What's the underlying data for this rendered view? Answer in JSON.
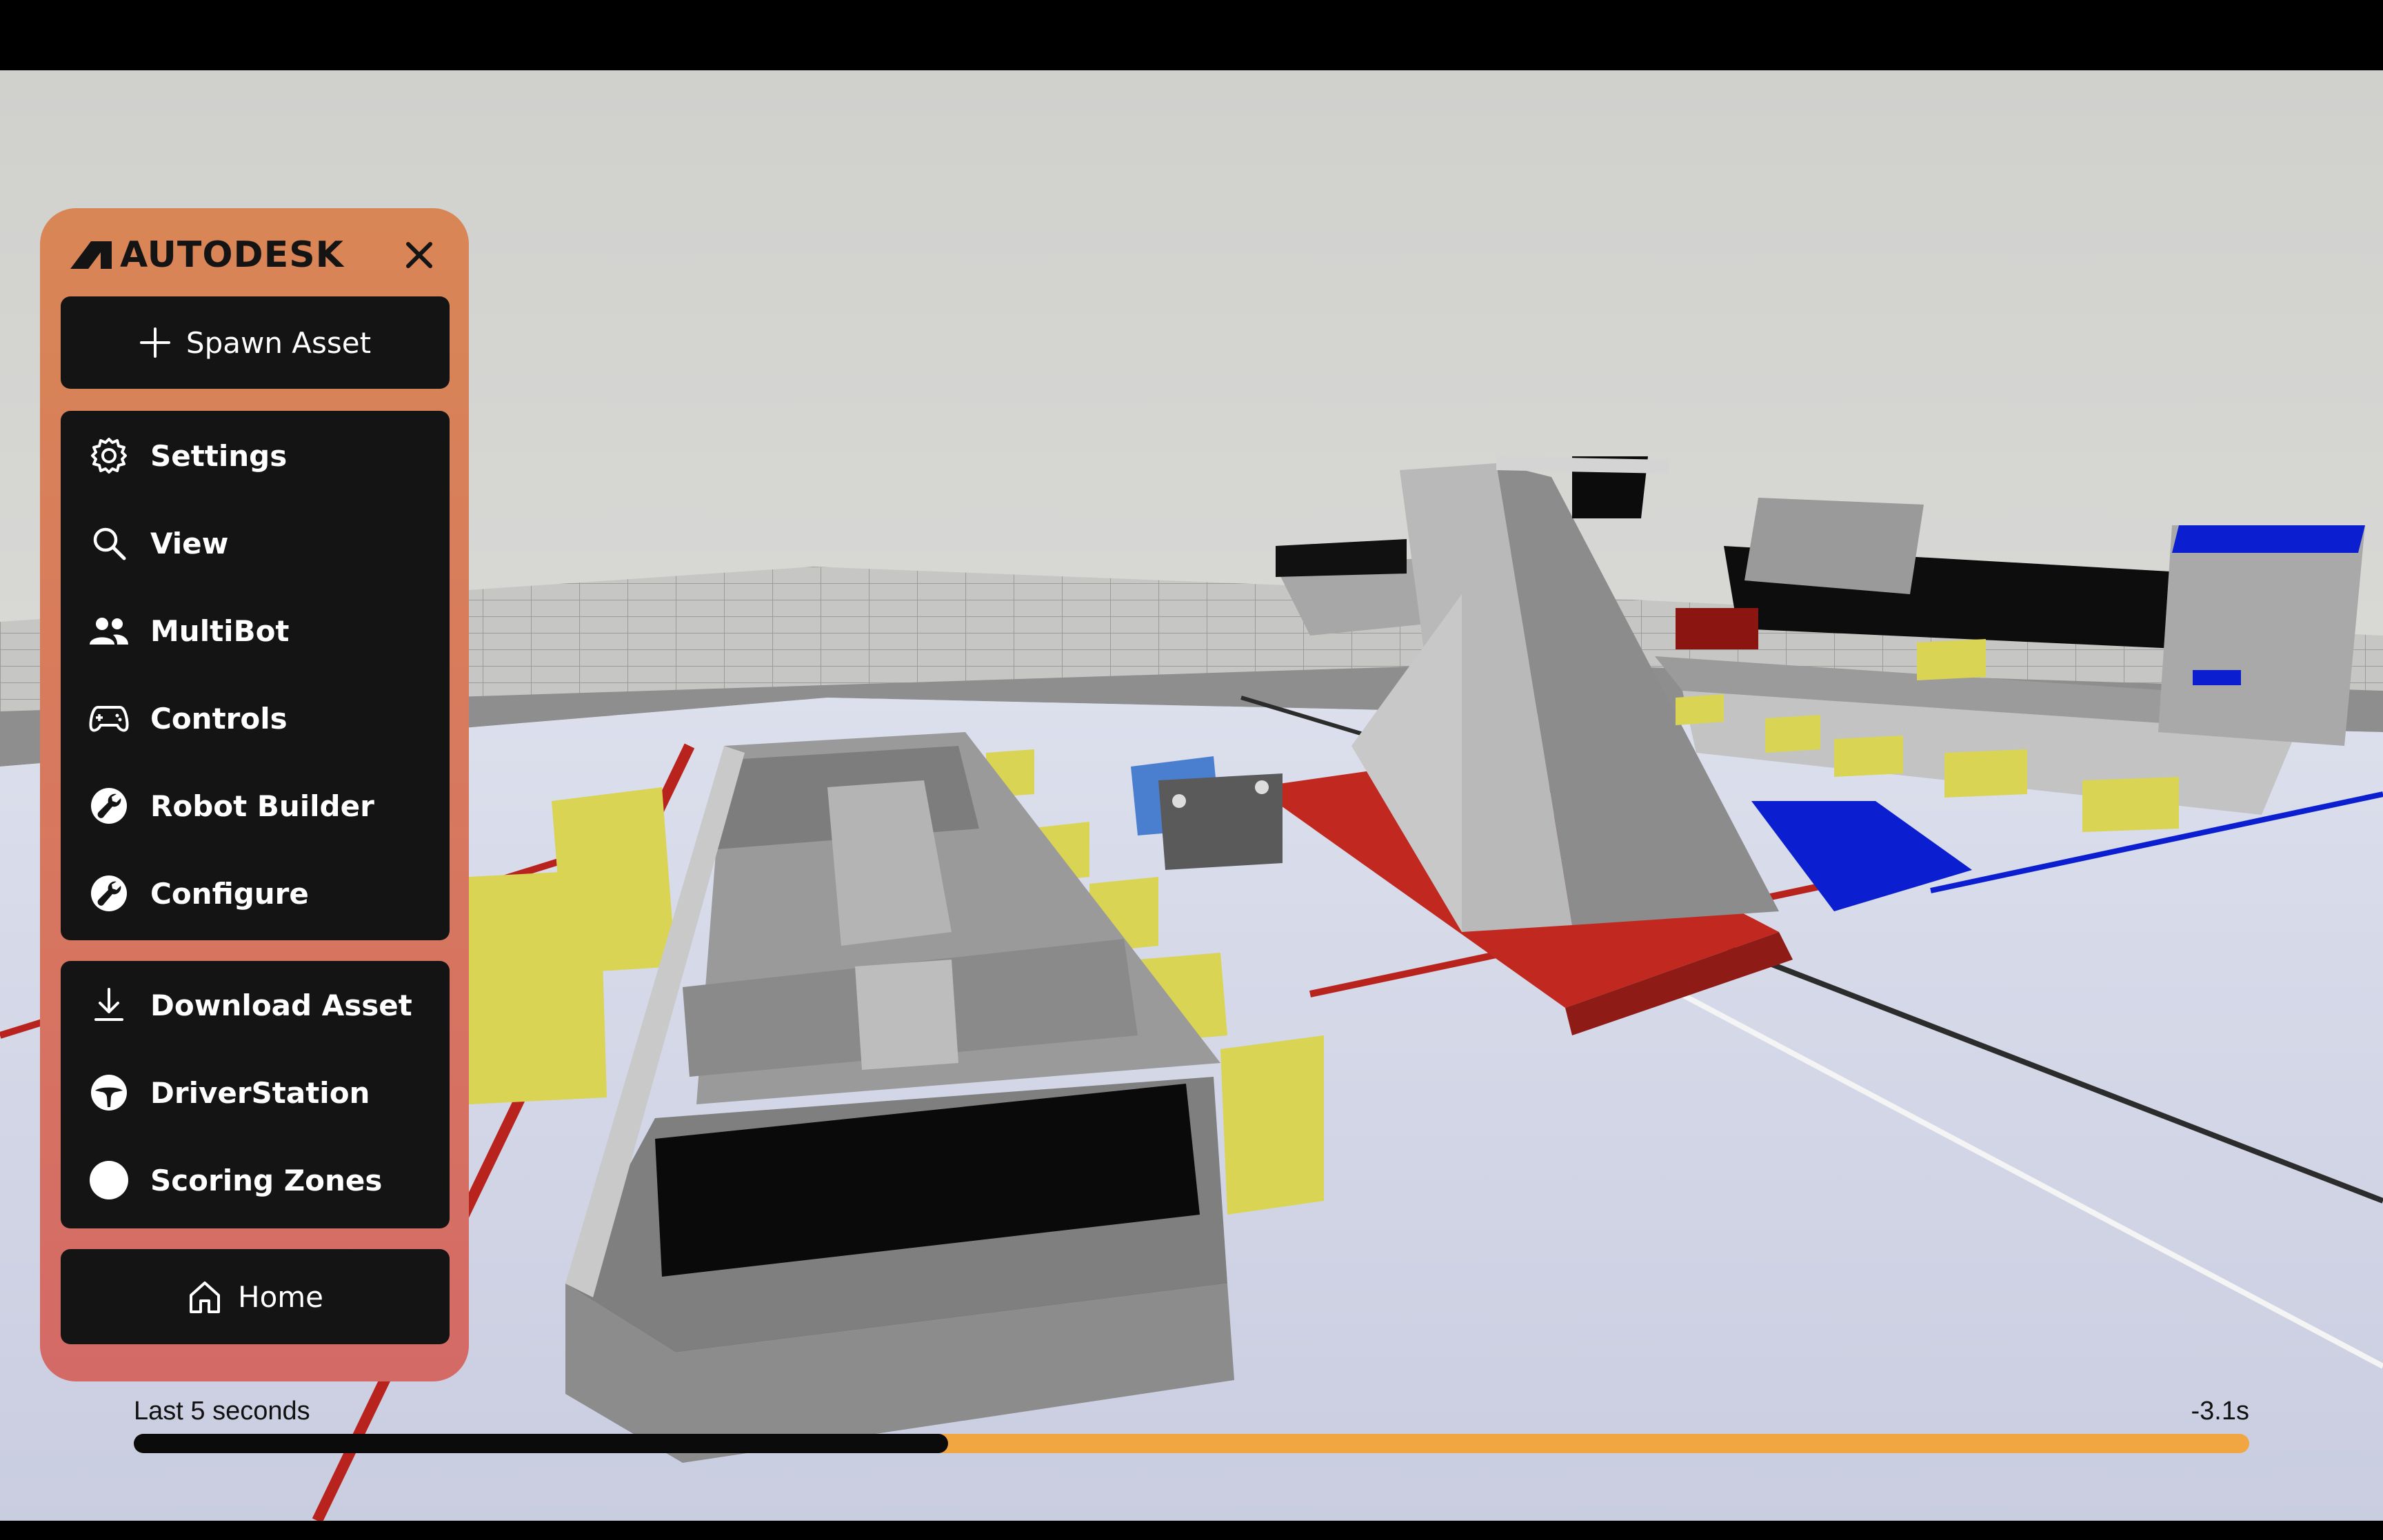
{
  "sidebar": {
    "brand": "AUTODESK",
    "spawn_label": "Spawn Asset",
    "group1": [
      {
        "label": "Settings",
        "icon": "gear-icon"
      },
      {
        "label": "View",
        "icon": "magnifier-icon"
      },
      {
        "label": "MultiBot",
        "icon": "people-icon"
      },
      {
        "label": "Controls",
        "icon": "gamepad-icon"
      },
      {
        "label": "Robot Builder",
        "icon": "robot-builder-icon"
      },
      {
        "label": "Configure",
        "icon": "configure-icon"
      }
    ],
    "group2": [
      {
        "label": "Download Asset",
        "icon": "download-icon"
      },
      {
        "label": "DriverStation",
        "icon": "steering-wheel-icon"
      },
      {
        "label": "Scoring Zones",
        "icon": "circle-icon"
      }
    ],
    "home_label": "Home"
  },
  "timeline": {
    "left_label": "Last 5 seconds",
    "right_label": "-3.1s",
    "progress": 0.385
  },
  "colors": {
    "panel": "#d98656",
    "card": "#141414",
    "timeline_track": "#f2a641",
    "timeline_fill": "#0b0b0b",
    "field_red": "#b8231e",
    "field_blue": "#0b1ed0",
    "game_piece_yellow": "#d9d453"
  }
}
